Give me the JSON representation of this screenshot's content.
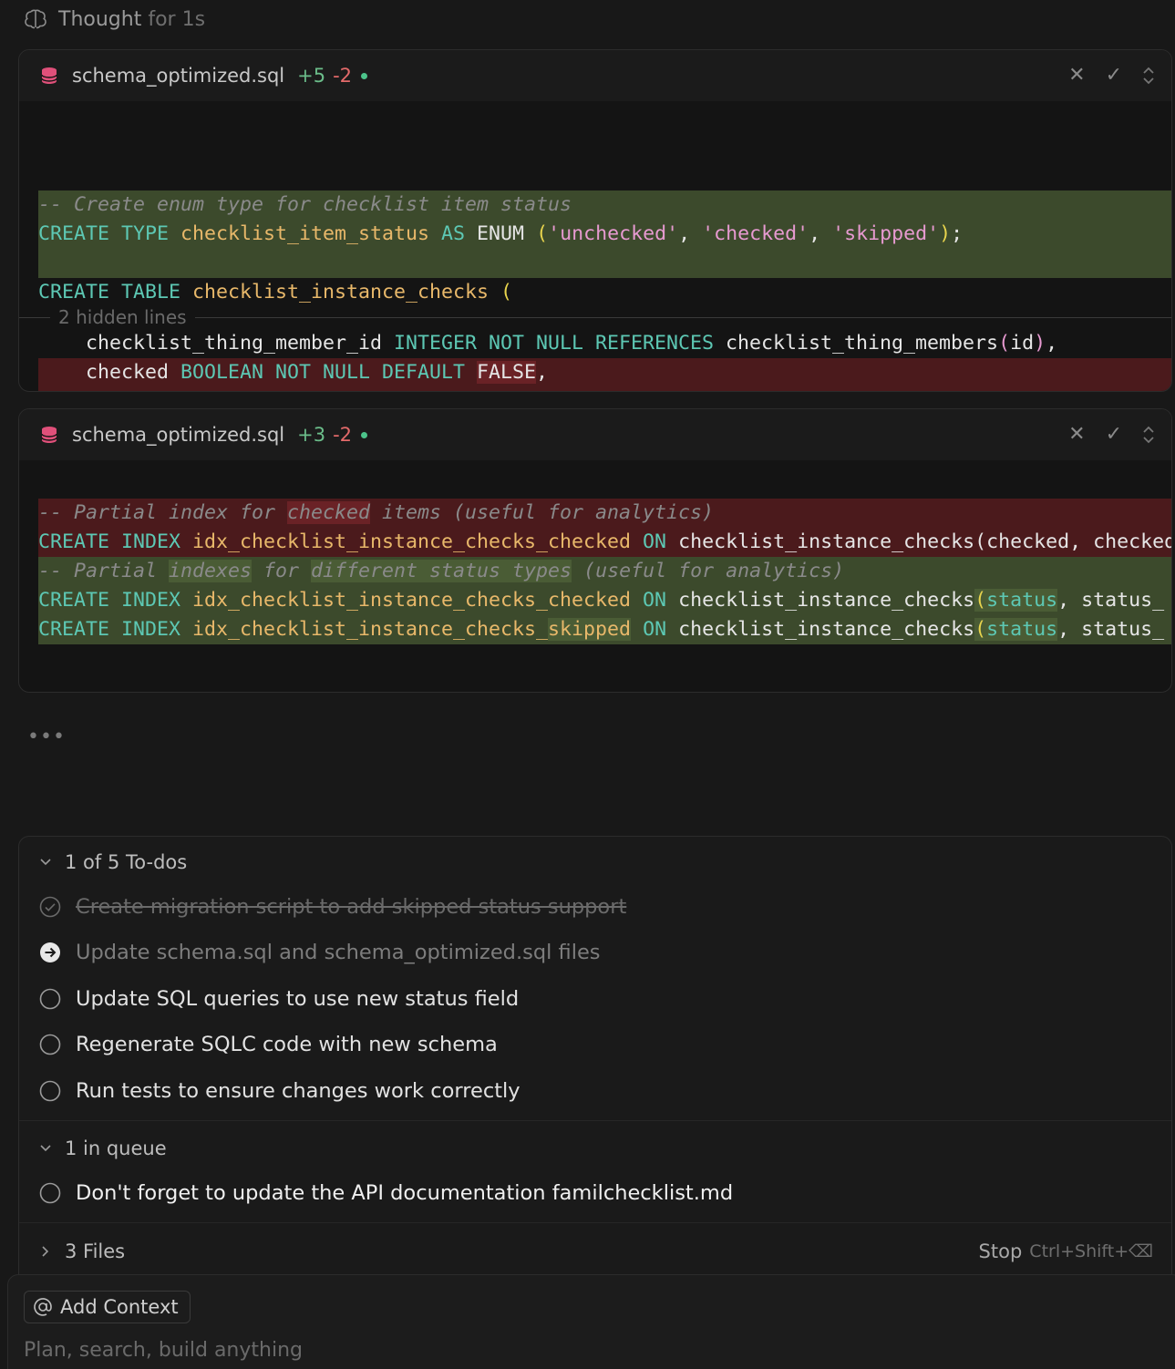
{
  "thought": {
    "label": "Thought",
    "duration": "for 1s"
  },
  "diff_panels": [
    {
      "filename": "schema_optimized.sql",
      "additions": "+5",
      "deletions": "-2",
      "hidden_lines": "2 hidden lines"
    },
    {
      "filename": "schema_optimized.sql",
      "additions": "+3",
      "deletions": "-2"
    }
  ],
  "todos": {
    "header": "1 of 5 To-dos",
    "items": [
      {
        "text": "Create migration script to add skipped status support",
        "status": "done"
      },
      {
        "text": "Update schema.sql and schema_optimized.sql files",
        "status": "in-progress"
      },
      {
        "text": "Update SQL queries to use new status field",
        "status": "pending"
      },
      {
        "text": "Regenerate SQLC code with new schema",
        "status": "pending"
      },
      {
        "text": "Run tests to ensure changes work correctly",
        "status": "pending"
      }
    ]
  },
  "queue": {
    "header": "1 in queue",
    "items": [
      {
        "text": "Don't forget to update the API documentation familchecklist.md"
      }
    ]
  },
  "files": {
    "header": "3 Files"
  },
  "stop": {
    "label": "Stop",
    "shortcut": "Ctrl+Shift+⌫"
  },
  "composer": {
    "add_context": "Add Context",
    "placeholder": "Plan, search, build anything"
  },
  "colors": {
    "addition_bg": "#3c4a2c",
    "deletion_bg": "#4b1a1c",
    "keyword": "#5dc8b4",
    "identifier": "#e8b86a",
    "string": "#e79ad1",
    "comment": "#8a8a8a"
  }
}
